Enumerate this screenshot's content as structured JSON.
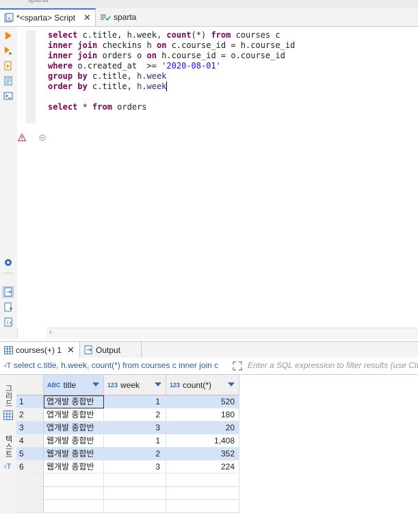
{
  "top_strip": {
    "label": "sparta"
  },
  "editor_tabs": [
    {
      "label": "*<sparta> Script",
      "active": true,
      "closable": true
    },
    {
      "label": "sparta",
      "active": false
    }
  ],
  "code_lines": [
    "select c.title, h.week, count(*) from courses c",
    "inner join checkins h on c.course_id = h.course_id",
    "inner join orders o on h.course_id = o.course_id",
    "where o.created_at  >= '2020-08-01'",
    "group by c.title, h.week",
    "order by c.title, h.week",
    "",
    "select * from orders"
  ],
  "result_tabs": [
    {
      "label": "courses(+) 1",
      "active": true,
      "closable": true
    },
    {
      "label": "Output",
      "active": false
    }
  ],
  "filter": {
    "query": "select c.title, h.week, count(*) from courses c inner join c",
    "placeholder": "Enter a SQL expression to filter results (use Ctrl"
  },
  "side_tabs": {
    "grid": "그리드",
    "text": "텍스트"
  },
  "grid": {
    "columns": [
      {
        "type": "ABC",
        "name": "title"
      },
      {
        "type": "123",
        "name": "week"
      },
      {
        "type": "123",
        "name": "count(*)"
      }
    ],
    "rows": [
      {
        "n": "1",
        "title": "앱개발 종합반",
        "week": "1",
        "count": "520"
      },
      {
        "n": "2",
        "title": "앱개발 종합반",
        "week": "2",
        "count": "180"
      },
      {
        "n": "3",
        "title": "앱개발 종합반",
        "week": "3",
        "count": "20"
      },
      {
        "n": "4",
        "title": "웹개발 종합반",
        "week": "1",
        "count": "1,408"
      },
      {
        "n": "5",
        "title": "웹개발 종합반",
        "week": "2",
        "count": "352"
      },
      {
        "n": "6",
        "title": "웹개발 종합반",
        "week": "3",
        "count": "224"
      }
    ]
  },
  "colors": {
    "keyword": "#7f0055",
    "string": "#2a00ff",
    "accent": "#2f6db5",
    "selection": "#d4e3f7"
  }
}
